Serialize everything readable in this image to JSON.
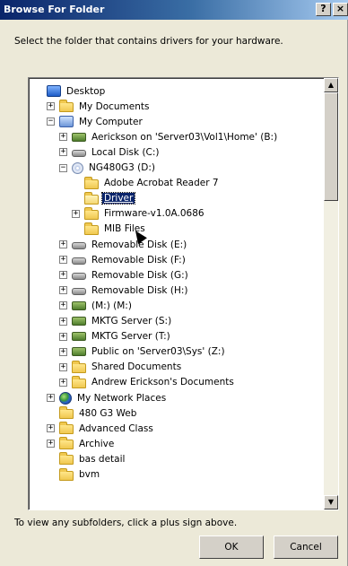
{
  "window": {
    "title": "Browse For Folder",
    "help_glyph": "?",
    "close_glyph": "×"
  },
  "instruction": "Select the folder that contains drivers for your hardware.",
  "tree": {
    "nodes": [
      {
        "label": "Desktop",
        "icon": "desktop-icon",
        "expander": ""
      },
      {
        "label": "My Documents",
        "icon": "my-documents-icon",
        "expander": "+"
      },
      {
        "label": "My Computer",
        "icon": "my-computer-icon",
        "expander": "−"
      },
      {
        "label": "Aerickson on 'Server03\\Vol1\\Home' (B:)",
        "icon": "network-drive-icon",
        "expander": "+"
      },
      {
        "label": "Local Disk (C:)",
        "icon": "hard-disk-icon",
        "expander": "+"
      },
      {
        "label": "NG480G3 (D:)",
        "icon": "cd-drive-icon",
        "expander": "−"
      },
      {
        "label": "Adobe Acrobat Reader 7",
        "icon": "folder-icon",
        "expander": ""
      },
      {
        "label": "Driver",
        "icon": "open-folder-icon",
        "expander": "",
        "selected": true
      },
      {
        "label": "Firmware-v1.0A.0686",
        "icon": "folder-icon",
        "expander": "+"
      },
      {
        "label": "MIB Files",
        "icon": "folder-icon",
        "expander": ""
      },
      {
        "label": "Removable Disk (E:)",
        "icon": "removable-disk-icon",
        "expander": "+"
      },
      {
        "label": "Removable Disk (F:)",
        "icon": "removable-disk-icon",
        "expander": "+"
      },
      {
        "label": "Removable Disk (G:)",
        "icon": "removable-disk-icon",
        "expander": "+"
      },
      {
        "label": "Removable Disk (H:)",
        "icon": "removable-disk-icon",
        "expander": "+"
      },
      {
        "label": "(M:) (M:)",
        "icon": "network-drive-icon",
        "expander": "+"
      },
      {
        "label": "MKTG Server (S:)",
        "icon": "network-drive-icon",
        "expander": "+"
      },
      {
        "label": "MKTG Server (T:)",
        "icon": "network-drive-icon",
        "expander": "+"
      },
      {
        "label": "Public on 'Server03\\Sys' (Z:)",
        "icon": "network-drive-icon",
        "expander": "+"
      },
      {
        "label": "Shared Documents",
        "icon": "folder-icon",
        "expander": "+"
      },
      {
        "label": "Andrew Erickson's Documents",
        "icon": "folder-icon",
        "expander": "+"
      },
      {
        "label": "My Network Places",
        "icon": "network-places-icon",
        "expander": "+"
      },
      {
        "label": "480 G3 Web",
        "icon": "folder-icon",
        "expander": ""
      },
      {
        "label": "Advanced Class",
        "icon": "folder-icon",
        "expander": "+"
      },
      {
        "label": "Archive",
        "icon": "folder-icon",
        "expander": "+"
      },
      {
        "label": "bas detail",
        "icon": "folder-icon",
        "expander": ""
      },
      {
        "label": "bvm",
        "icon": "folder-icon",
        "expander": ""
      }
    ]
  },
  "scrollbar": {
    "up_glyph": "▲",
    "down_glyph": "▼"
  },
  "hint": "To view any subfolders, click a plus sign above.",
  "buttons": {
    "ok": "OK",
    "cancel": "Cancel"
  }
}
